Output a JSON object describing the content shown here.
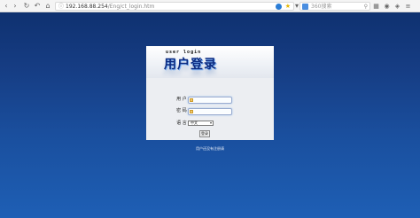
{
  "browser": {
    "url_host": "192.168.88.254",
    "url_path": "/Eng/ct_login.htm",
    "search_placeholder": "360搜索"
  },
  "login": {
    "header_english": "user login",
    "header_title": "用户登录",
    "fields": {
      "username_label": "用 户 :",
      "password_label": "密 码 :",
      "language_label": "语 言 :",
      "language_value": "中文"
    },
    "submit_label": "登录",
    "footer_text": "用户还没有注册请"
  },
  "colors": {
    "page_top": "#0f3170",
    "page_bottom": "#1e5fb5",
    "title_blue": "#0b2a80"
  }
}
